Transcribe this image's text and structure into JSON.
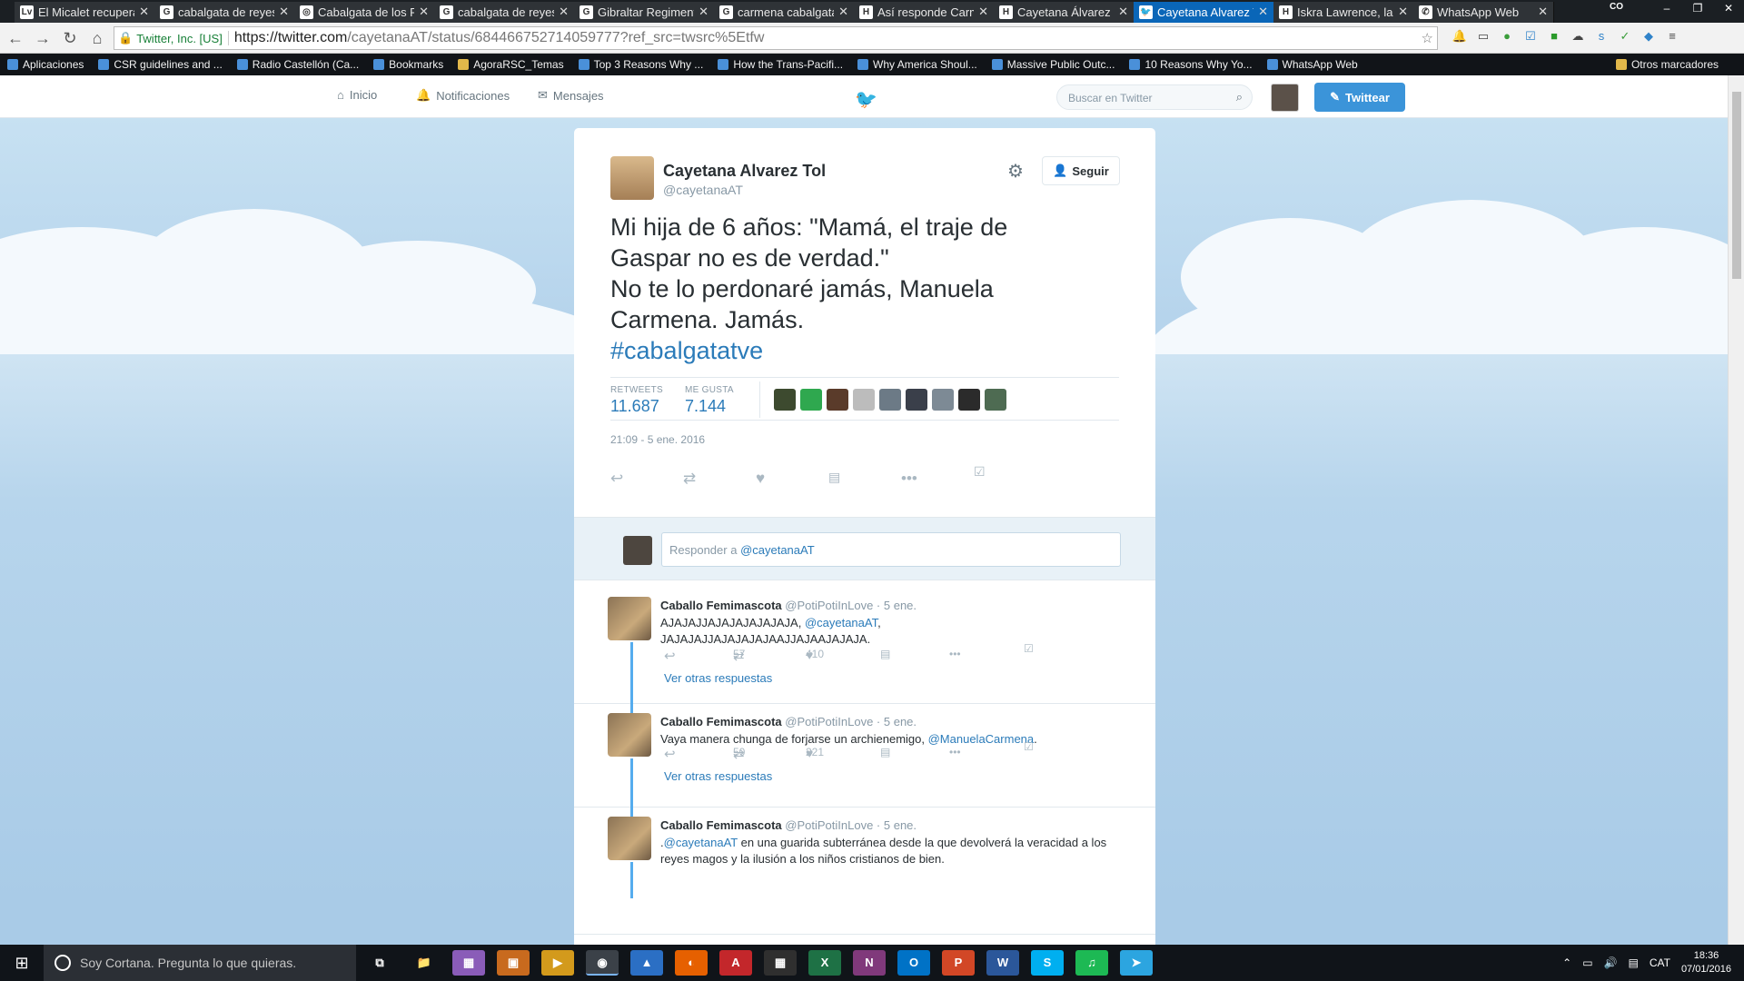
{
  "browser": {
    "tabs": [
      {
        "label": "El Micalet recupera",
        "favicon": "Lv",
        "color": "#ffffff"
      },
      {
        "label": "cabalgata de reyes",
        "favicon": "G",
        "color": "#ffffff"
      },
      {
        "label": "Cabalgata de los R",
        "favicon": "◎",
        "color": "#ffffff"
      },
      {
        "label": "cabalgata de reyes",
        "favicon": "G",
        "color": "#ffffff"
      },
      {
        "label": "Gibraltar Regiment",
        "favicon": "G",
        "color": "#ffffff"
      },
      {
        "label": "carmena cabalgata",
        "favicon": "G",
        "color": "#ffffff"
      },
      {
        "label": "Así responde Carm",
        "favicon": "H",
        "color": "#ffffff"
      },
      {
        "label": "Cayetana Álvarez d",
        "favicon": "H",
        "color": "#ffffff"
      },
      {
        "label": "Cayetana Alvarez T",
        "favicon": "🐦",
        "color": "#ffffff",
        "active": true
      },
      {
        "label": "Iskra Lawrence, la n",
        "favicon": "H",
        "color": "#ffffff"
      },
      {
        "label": "WhatsApp Web",
        "favicon": "✆",
        "color": "#ffffff"
      }
    ],
    "profile_label": "CO",
    "window_controls": [
      "–",
      "❐",
      "✕"
    ],
    "ev_badge": "Twitter, Inc. [US]",
    "url_host": "https://twitter.com",
    "url_rest": "/cayetanaAT/status/684466752714059777?ref_src=twsrc%5Etfw",
    "bookmarks": [
      {
        "label": "Aplicaciones",
        "icon": "apps-icon"
      },
      {
        "label": "CSR guidelines and ...",
        "icon": "globe-icon"
      },
      {
        "label": "Radio Castellón (Ca...",
        "icon": "radio-icon"
      },
      {
        "label": "Bookmarks",
        "icon": "star-icon"
      },
      {
        "label": "AgoraRSC_Temas",
        "icon": "folder-icon"
      },
      {
        "label": "Top 3 Reasons Why ...",
        "icon": "globe-icon"
      },
      {
        "label": "How the Trans-Pacifi...",
        "icon": "page-icon"
      },
      {
        "label": "Why America Shoul...",
        "icon": "page-icon"
      },
      {
        "label": "Massive Public Outc...",
        "icon": "ctc-icon"
      },
      {
        "label": "10 Reasons Why Yo...",
        "icon": "page-icon"
      },
      {
        "label": "WhatsApp Web",
        "icon": "whatsapp-icon"
      }
    ],
    "other_bookmarks": "Otros marcadores"
  },
  "twitter_nav": {
    "home": "Inicio",
    "notifications": "Notificaciones",
    "messages": "Mensajes",
    "search_placeholder": "Buscar en Twitter",
    "tweet_button": "Twittear"
  },
  "tweet": {
    "author_name": "Cayetana Alvarez Tol",
    "author_handle": "@cayetanaAT",
    "follow_label": "Seguir",
    "text_line1": "Mi hija de 6 años: \"Mamá, el traje de Gaspar no es de verdad.\"",
    "text_line2": "No te lo perdonaré jamás, Manuela Carmena. Jamás.",
    "hashtag": "#cabalgatatve",
    "retweets_label": "RETWEETS",
    "retweets_value": "11.687",
    "likes_label": "ME GUSTA",
    "likes_value": "7.144",
    "timestamp": "21:09 - 5 ene. 2016",
    "likers_colors": [
      "#3d4a2f",
      "#2fa84f",
      "#5a3b2a",
      "#bcbcbc",
      "#6c7a86",
      "#3a3f4a",
      "#7d8a95",
      "#2b2b2b",
      "#4e6b52"
    ]
  },
  "reply_box": {
    "placeholder_prefix": "Responder a ",
    "placeholder_mention": "@cayetanaAT"
  },
  "replies": [
    {
      "name": "Caballo Femimascota",
      "handle": "@PotiPotiInLove",
      "time": "5 ene.",
      "text_a": "AJAJAJJAJAJAJAJAJAJA, ",
      "mention_a": "@cayetanaAT",
      "text_b": ",",
      "text_c": "JAJAJAJJAJAJAJAJAAJJAJAAJAJAJA.",
      "retweets": "57",
      "likes": "410",
      "more": "Ver otras respuestas"
    },
    {
      "name": "Caballo Femimascota",
      "handle": "@PotiPotiInLove",
      "time": "5 ene.",
      "text_a": "Vaya manera chunga de forjarse un archienemigo, ",
      "mention_a": "@ManuelaCarmena",
      "text_b": ".",
      "text_c": "",
      "retweets": "50",
      "likes": "221",
      "more": "Ver otras respuestas"
    },
    {
      "name": "Caballo Femimascota",
      "handle": "@PotiPotiInLove",
      "time": "5 ene.",
      "text_a": ".",
      "mention_a": "@cayetanaAT",
      "text_b": " en una guarida subterránea desde la que devolverá la veracidad a los reyes magos y la ilusión a los niños cristianos de bien.",
      "text_c": "",
      "retweets": "",
      "likes": "",
      "more": ""
    }
  ],
  "taskbar": {
    "cortana_placeholder": "Soy Cortana. Pregunta lo que quieras.",
    "apps": [
      {
        "name": "task-view",
        "glyph": "⧉",
        "color": "#101419"
      },
      {
        "name": "file-explorer",
        "glyph": "📁",
        "color": "#101419"
      },
      {
        "name": "app-tiles",
        "glyph": "▦",
        "color": "#8a5cb8"
      },
      {
        "name": "app-orange",
        "glyph": "▣",
        "color": "#c86a1e"
      },
      {
        "name": "media-player",
        "glyph": "▶",
        "color": "#d39a1c"
      },
      {
        "name": "chrome",
        "glyph": "◉",
        "color": "#3b4148",
        "active": true
      },
      {
        "name": "app-blue",
        "glyph": "▲",
        "color": "#2b6fc4"
      },
      {
        "name": "firefox",
        "glyph": "◐",
        "color": "#e66000"
      },
      {
        "name": "acrobat",
        "glyph": "A",
        "color": "#c3272b"
      },
      {
        "name": "calculator",
        "glyph": "▦",
        "color": "#2f2f2f"
      },
      {
        "name": "excel",
        "glyph": "X",
        "color": "#1e7145"
      },
      {
        "name": "onenote",
        "glyph": "N",
        "color": "#80397b"
      },
      {
        "name": "outlook",
        "glyph": "O",
        "color": "#0072c6"
      },
      {
        "name": "powerpoint",
        "glyph": "P",
        "color": "#d24726"
      },
      {
        "name": "word",
        "glyph": "W",
        "color": "#2b579a"
      },
      {
        "name": "skype",
        "glyph": "S",
        "color": "#00aff0"
      },
      {
        "name": "spotify",
        "glyph": "♫",
        "color": "#1db954"
      },
      {
        "name": "telegram",
        "glyph": "➤",
        "color": "#2ca5e0"
      }
    ],
    "language": "CAT",
    "time": "18:36",
    "date": "07/01/2016"
  }
}
